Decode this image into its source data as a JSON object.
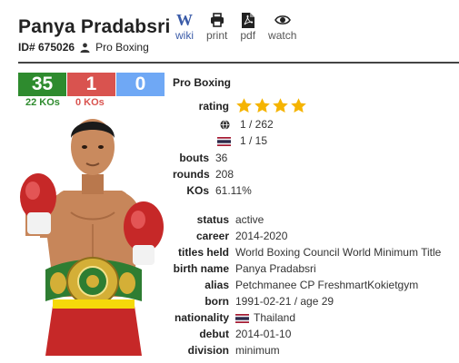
{
  "boxer": {
    "name": "Panya Pradabsri",
    "id_label": "ID# 675026",
    "category": "Pro Boxing"
  },
  "actions": [
    {
      "label": "wiki",
      "icon": "wikipedia-icon"
    },
    {
      "label": "print",
      "icon": "printer-icon"
    },
    {
      "label": "pdf",
      "icon": "pdf-file-icon"
    },
    {
      "label": "watch",
      "icon": "eye-icon"
    }
  ],
  "record": {
    "wins": "35",
    "losses": "1",
    "draws": "0",
    "win_kos": "22 KOs",
    "loss_kos": "0 KOs"
  },
  "profile": {
    "section_title": "Pro Boxing",
    "rating_label": "rating",
    "rating_stars": 4,
    "world_rank": "1 / 262",
    "national_rank": "1 / 15",
    "bouts_label": "bouts",
    "bouts": "36",
    "rounds_label": "rounds",
    "rounds": "208",
    "kos_label": "KOs",
    "kos_pct": "61.11%",
    "status_label": "status",
    "status": "active",
    "career_label": "career",
    "career": "2014-2020",
    "titles_label": "titles held",
    "titles": "World Boxing Council World Minimum Title",
    "birthname_label": "birth name",
    "birthname": "Panya Pradabsri",
    "alias_label": "alias",
    "alias": "Petchmanee CP FreshmartKokietgym",
    "born_label": "born",
    "born": "1991-02-21 / age 29",
    "nationality_label": "nationality",
    "nationality": "Thailand",
    "debut_label": "debut",
    "debut": "2014-01-10",
    "division_label": "division",
    "division": "minimum"
  },
  "colors": {
    "win": "#2e8b2e",
    "loss": "#d9534f",
    "draw": "#6fa8f5",
    "star": "#f5b400",
    "wiki": "#3a5ba8"
  }
}
